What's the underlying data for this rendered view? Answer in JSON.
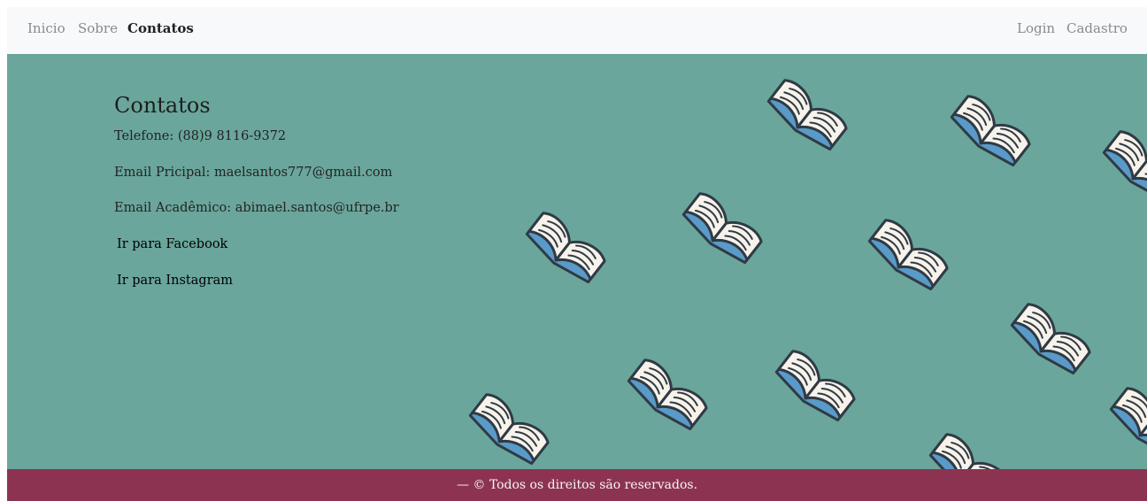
{
  "nav": {
    "left": [
      "Inicio",
      "Sobre",
      "Contatos"
    ],
    "active": "Contatos",
    "right": [
      "Login",
      "Cadastro"
    ]
  },
  "contact": {
    "title": "Contatos",
    "phone": "Telefone: (88)9 8116-9372",
    "email_primary": "Email Pricipal: maelsantos777@gmail.com",
    "email_academic": "Email Acadêmico: abimael.santos@ufrpe.br",
    "facebook_link": "Ir para Facebook",
    "instagram_link": "Ir para Instagram"
  },
  "footer": {
    "text": "— © Todos os direitos são reservados."
  },
  "colors": {
    "navbar_bg": "#f8f9fa",
    "hero_bg": "#6aa69b",
    "footer_bg": "#8d3352",
    "book_page": "#f7f2ea",
    "book_cover": "#5a9ac8",
    "book_outline": "#2f3a44"
  },
  "icons": {
    "background_pattern": "open-book-icon"
  }
}
